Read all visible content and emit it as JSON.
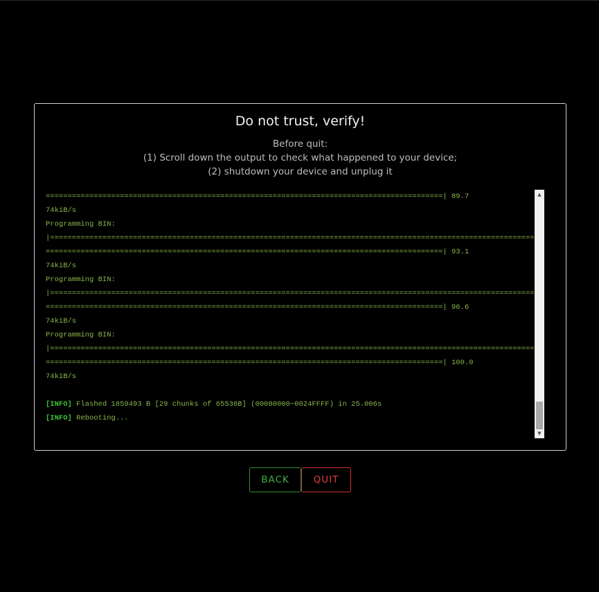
{
  "dialog": {
    "title": "Do not trust, verify!",
    "instructions": [
      "Before quit:",
      "(1) Scroll down the output to check what happened to your device;",
      "(2) shutdown your device and unplug it"
    ]
  },
  "console": {
    "lines": [
      {
        "text": "===========================================================================================| 89.7"
      },
      {
        "text": "74kiB/s"
      },
      {
        "text": "Programming BIN:"
      },
      {
        "text": "|================================================================================================================================"
      },
      {
        "text": "===========================================================================================| 93.1"
      },
      {
        "text": "74kiB/s"
      },
      {
        "text": "Programming BIN:"
      },
      {
        "text": "|================================================================================================================================"
      },
      {
        "text": "===========================================================================================| 96.6"
      },
      {
        "text": "74kiB/s"
      },
      {
        "text": "Programming BIN:"
      },
      {
        "text": "|================================================================================================================================"
      },
      {
        "text": "===========================================================================================| 100.0"
      },
      {
        "text": "74kiB/s"
      },
      {
        "text": ""
      },
      {
        "tag": "[INFO]",
        "text": " Flashed 1859493 B [29 chunks of 65536B] (00080000~0024FFFF) in 25.006s"
      },
      {
        "tag": "[INFO]",
        "text": " Rebooting..."
      }
    ],
    "colors": {
      "text": "#8ab74a",
      "tag": "#3fc23a"
    }
  },
  "buttons": {
    "back_label": "BACK",
    "quit_label": "QUIT"
  },
  "colors": {
    "background": "#000000",
    "back_accent": "#3fae44",
    "quit_accent": "#e03a3a"
  }
}
